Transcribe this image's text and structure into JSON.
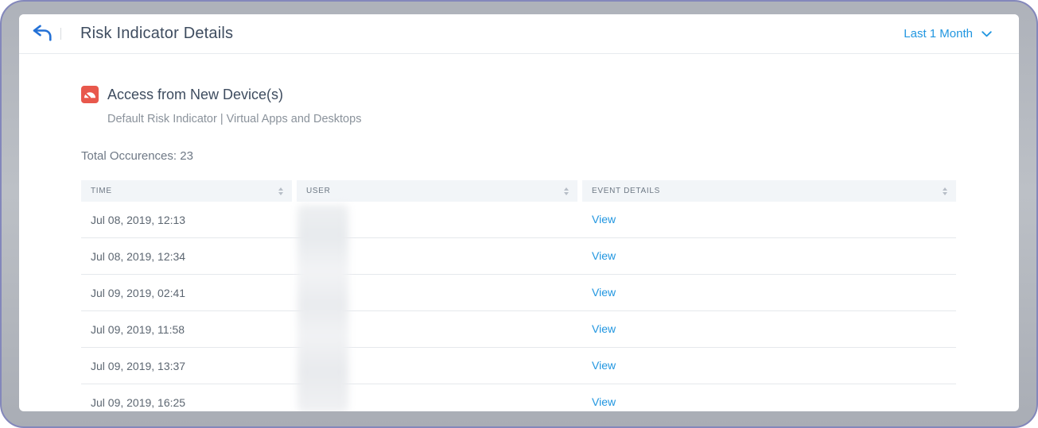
{
  "topbar": {
    "title": "Risk Indicator Details",
    "time_filter": {
      "label": "Last 1 Month"
    }
  },
  "indicator": {
    "title": "Access from New Device(s)",
    "subtitle": "Default Risk Indicator | Virtual Apps and Desktops",
    "total_occurrences_label": "Total Occurences:",
    "total_occurrences": "23"
  },
  "table": {
    "columns": [
      {
        "label": "TIME"
      },
      {
        "label": "USER"
      },
      {
        "label": "EVENT DETAILS"
      }
    ],
    "rows": [
      {
        "time": "Jul 08, 2019, 12:13",
        "user": "",
        "event": "View"
      },
      {
        "time": "Jul 08, 2019, 12:34",
        "user": "",
        "event": "View"
      },
      {
        "time": "Jul 09, 2019, 02:41",
        "user": "",
        "event": "View"
      },
      {
        "time": "Jul 09, 2019, 11:58",
        "user": "",
        "event": "View"
      },
      {
        "time": "Jul 09, 2019, 13:37",
        "user": "",
        "event": "View"
      },
      {
        "time": "Jul 09, 2019, 16:25",
        "user": "",
        "event": "View"
      }
    ]
  },
  "icons": {
    "back": "back-arrow-icon",
    "risk": "risk-gauge-icon",
    "dropdown": "chevron-down-icon",
    "sort": "sort-arrows-icon"
  },
  "colors": {
    "accent_blue": "#2196e0",
    "back_arrow_blue": "#2471d6",
    "risk_icon_red": "#e8584c",
    "frame_gray": "#b1b5bc",
    "frame_outline_purple": "#8387bb"
  }
}
